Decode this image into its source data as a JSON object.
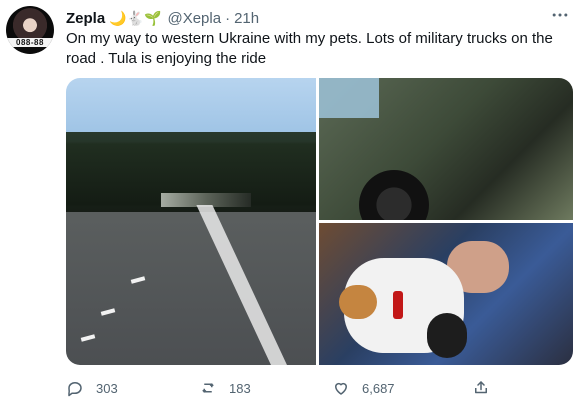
{
  "tweet": {
    "author": {
      "display_name": "Zepla",
      "name_emojis": "🌙🐇🌱",
      "handle": "@Xepla",
      "avatar_strip_text": "088-88"
    },
    "separator": "·",
    "timestamp": "21h",
    "more_icon": "more-icon",
    "text": "On my way to western Ukraine with my pets. Lots of military trucks on the road . Tula is enjoying the ride",
    "media": [
      {
        "label": "road"
      },
      {
        "label": "military truck"
      },
      {
        "label": "cat Tula in car"
      }
    ],
    "actions": {
      "replies": "303",
      "retweets": "183",
      "likes": "6,687"
    }
  }
}
